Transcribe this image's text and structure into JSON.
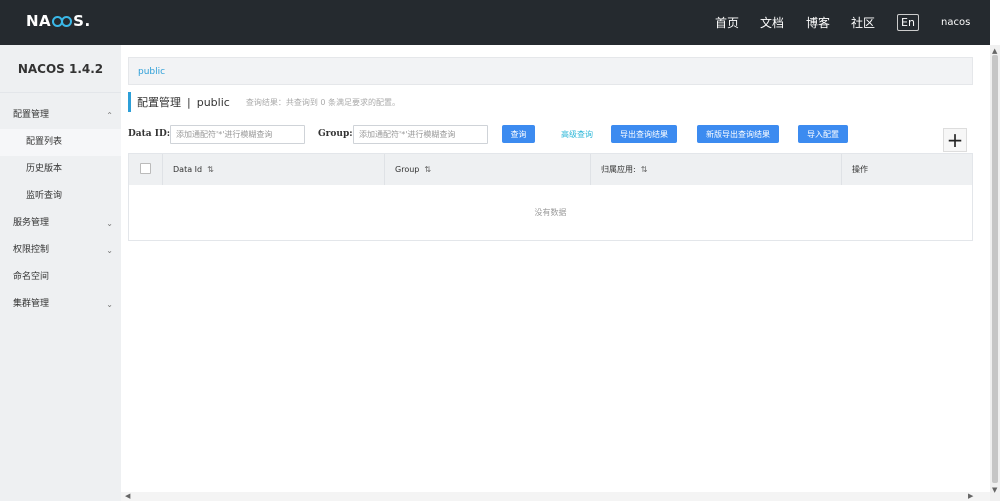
{
  "header": {
    "logo": "NACOS.",
    "nav": [
      "首页",
      "文档",
      "博客",
      "社区"
    ],
    "lang": "En",
    "user": "nacos"
  },
  "sidebar": {
    "version": "NACOS 1.4.2",
    "items": [
      {
        "label": "配置管理",
        "chevron": "up"
      },
      {
        "label": "配置列表"
      },
      {
        "label": "历史版本"
      },
      {
        "label": "监听查询"
      },
      {
        "label": "服务管理",
        "chevron": "down"
      },
      {
        "label": "权限控制",
        "chevron": "down"
      },
      {
        "label": "命名空间"
      },
      {
        "label": "集群管理",
        "chevron": "down"
      }
    ]
  },
  "namespace_bar": {
    "active": "public"
  },
  "page": {
    "title": "配置管理",
    "sep": "|",
    "namespace": "public",
    "hint": "查询结果：共查询到 0 条满足要求的配置。"
  },
  "filters": {
    "data_id_label": "Data ID:",
    "data_id_placeholder": "添加通配符'*'进行模糊查询",
    "group_label": "Group:",
    "group_placeholder": "添加通配符'*'进行模糊查询"
  },
  "buttons": {
    "search": "查询",
    "advanced": "高级查询",
    "export": "导出查询结果",
    "export_new": "新版导出查询结果",
    "import": "导入配置",
    "add": "+"
  },
  "table": {
    "columns": [
      "Data Id",
      "Group",
      "归属应用:",
      "操作"
    ],
    "sort_icon": "⇅",
    "empty": "没有数据"
  },
  "icons": {
    "chevron_up": "⌃",
    "chevron_down": "⌄",
    "scroll_up": "▲",
    "scroll_down": "▼",
    "scroll_left": "◀",
    "scroll_right": "▶"
  },
  "colors": {
    "topbar": "#252a2f",
    "accent": "#3c8bf0",
    "link": "#2db7d8"
  }
}
